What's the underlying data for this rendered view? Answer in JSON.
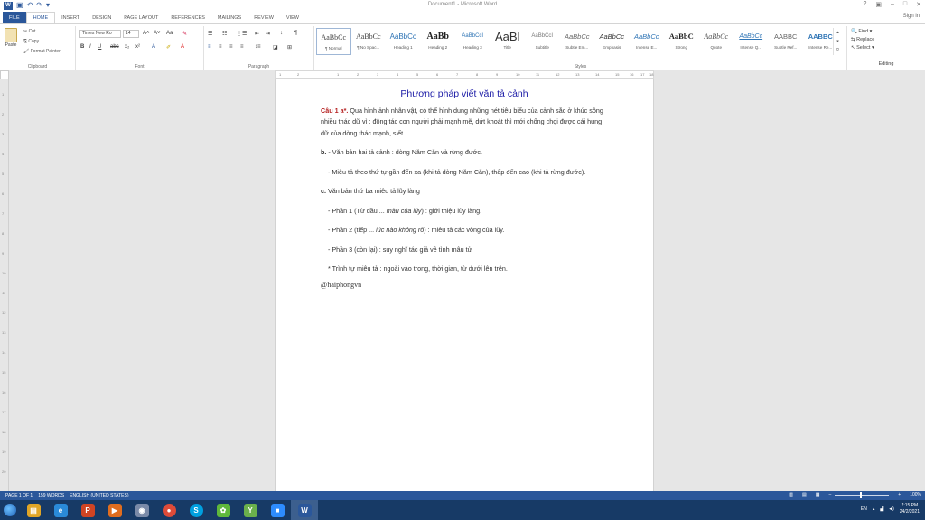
{
  "window": {
    "title": "Document1 - Microsoft Word",
    "controls": [
      "?",
      "▣",
      "–",
      "□",
      "✕"
    ],
    "sign_in": "Sign in"
  },
  "tabs": [
    "FILE",
    "HOME",
    "INSERT",
    "DESIGN",
    "PAGE LAYOUT",
    "REFERENCES",
    "MAILINGS",
    "REVIEW",
    "VIEW"
  ],
  "ribbon": {
    "clipboard": {
      "paste": "Paste",
      "cut": "Cut",
      "copy": "Copy",
      "format_painter": "Format Painter",
      "label": "Clipboard"
    },
    "font": {
      "name": "Times New Ro",
      "size": "14",
      "label": "Font"
    },
    "paragraph": {
      "label": "Paragraph"
    },
    "styles": {
      "label": "Styles",
      "items": [
        {
          "preview": "AaBbCc",
          "name": "¶ Normal"
        },
        {
          "preview": "AaBbCc",
          "name": "¶ No Spac..."
        },
        {
          "preview": "AaBbCc",
          "name": "Heading 1"
        },
        {
          "preview": "AaBb",
          "name": "Heading 2"
        },
        {
          "preview": "AaBbCcI",
          "name": "Heading 3"
        },
        {
          "preview": "AaBl",
          "name": "Title"
        },
        {
          "preview": "AaBbCcI",
          "name": "Subtitle"
        },
        {
          "preview": "AaBbCc",
          "name": "Subtle Em..."
        },
        {
          "preview": "AaBbCc",
          "name": "Emphasis"
        },
        {
          "preview": "AaBbCc",
          "name": "Intense E..."
        },
        {
          "preview": "AaBbC",
          "name": "Strong"
        },
        {
          "preview": "AaBbCc",
          "name": "Quote"
        },
        {
          "preview": "AaBbCc",
          "name": "Intense Q..."
        },
        {
          "preview": "AABBC",
          "name": "Subtle Ref..."
        },
        {
          "preview": "AABBC",
          "name": "Intense Re..."
        }
      ]
    },
    "editing": {
      "find": "Find",
      "replace": "Replace",
      "select": "Select",
      "label": "Editing"
    }
  },
  "ruler": [
    "1",
    "2",
    "1",
    "2",
    "3",
    "4",
    "5",
    "6",
    "7",
    "8",
    "9",
    "10",
    "11",
    "12",
    "13",
    "14",
    "15",
    "16",
    "17",
    "18"
  ],
  "document": {
    "title": "Phương pháp viết văn tả cảnh",
    "p1_label": "Câu 1 a*.",
    "p1_text": " Qua hình ảnh nhân vật, có thể hình dung những nét tiêu biểu của cảnh sắc ở khúc sông nhiều thác dữ vì : động tác con người phải mạnh mẽ, dứt khoát thì mới chống chọi được cái hung dữ của dòng thác mạnh, siết.",
    "p2_label": "b.",
    "p2_text": " - Văn bản hai tả cảnh : dòng Năm Căn và rừng đước.",
    "p3": "- Miêu tả theo thứ tự gần đến xa (khi tả dòng Năm Căn), thấp đến cao (khi tả rừng đước).",
    "p4_label": "c.",
    "p4_text": " Văn bản thứ ba miêu tả lũy làng",
    "p5_a": "- Phần 1 (Từ đầu ... ",
    "p5_i": "màu của lũy",
    "p5_b": ") : giới thiệu lũy làng.",
    "p6_a": "- Phần 2 (tiếp ... ",
    "p6_i": "lúc nào không rõ",
    "p6_b": ") : miêu tả các vòng của lũy.",
    "p7": "- Phần 3 (còn lại) : suy nghĩ tác giả về tình mẫu tử",
    "p8": "* Trình tự miêu tả : ngoài vào trong, thời gian, từ dưới lên trên.",
    "signature": "@haiphongvn"
  },
  "statusbar": {
    "page": "PAGE 1 OF 1",
    "words": "159 WORDS",
    "language": "ENGLISH (UNITED STATES)",
    "zoom": "100%"
  },
  "taskbar": {
    "apps": [
      {
        "glyph": "▤",
        "color": "#e0a526"
      },
      {
        "glyph": "e",
        "color": "#2a8ad8"
      },
      {
        "glyph": "P",
        "color": "#d04423"
      },
      {
        "glyph": "▶",
        "color": "#e06d1f"
      },
      {
        "glyph": "◉",
        "color": "#7a8aa8"
      },
      {
        "glyph": "●",
        "color": "#dd4b39"
      },
      {
        "glyph": "S",
        "color": "#00a0e0"
      },
      {
        "glyph": "✿",
        "color": "#5fb83b"
      },
      {
        "glyph": "Y",
        "color": "#6ab04c"
      },
      {
        "glyph": "■",
        "color": "#2d8cff"
      },
      {
        "glyph": "W",
        "color": "#2b579a"
      }
    ],
    "lang": "EN",
    "time": "7:15 PM",
    "date": "24/2/2021"
  }
}
